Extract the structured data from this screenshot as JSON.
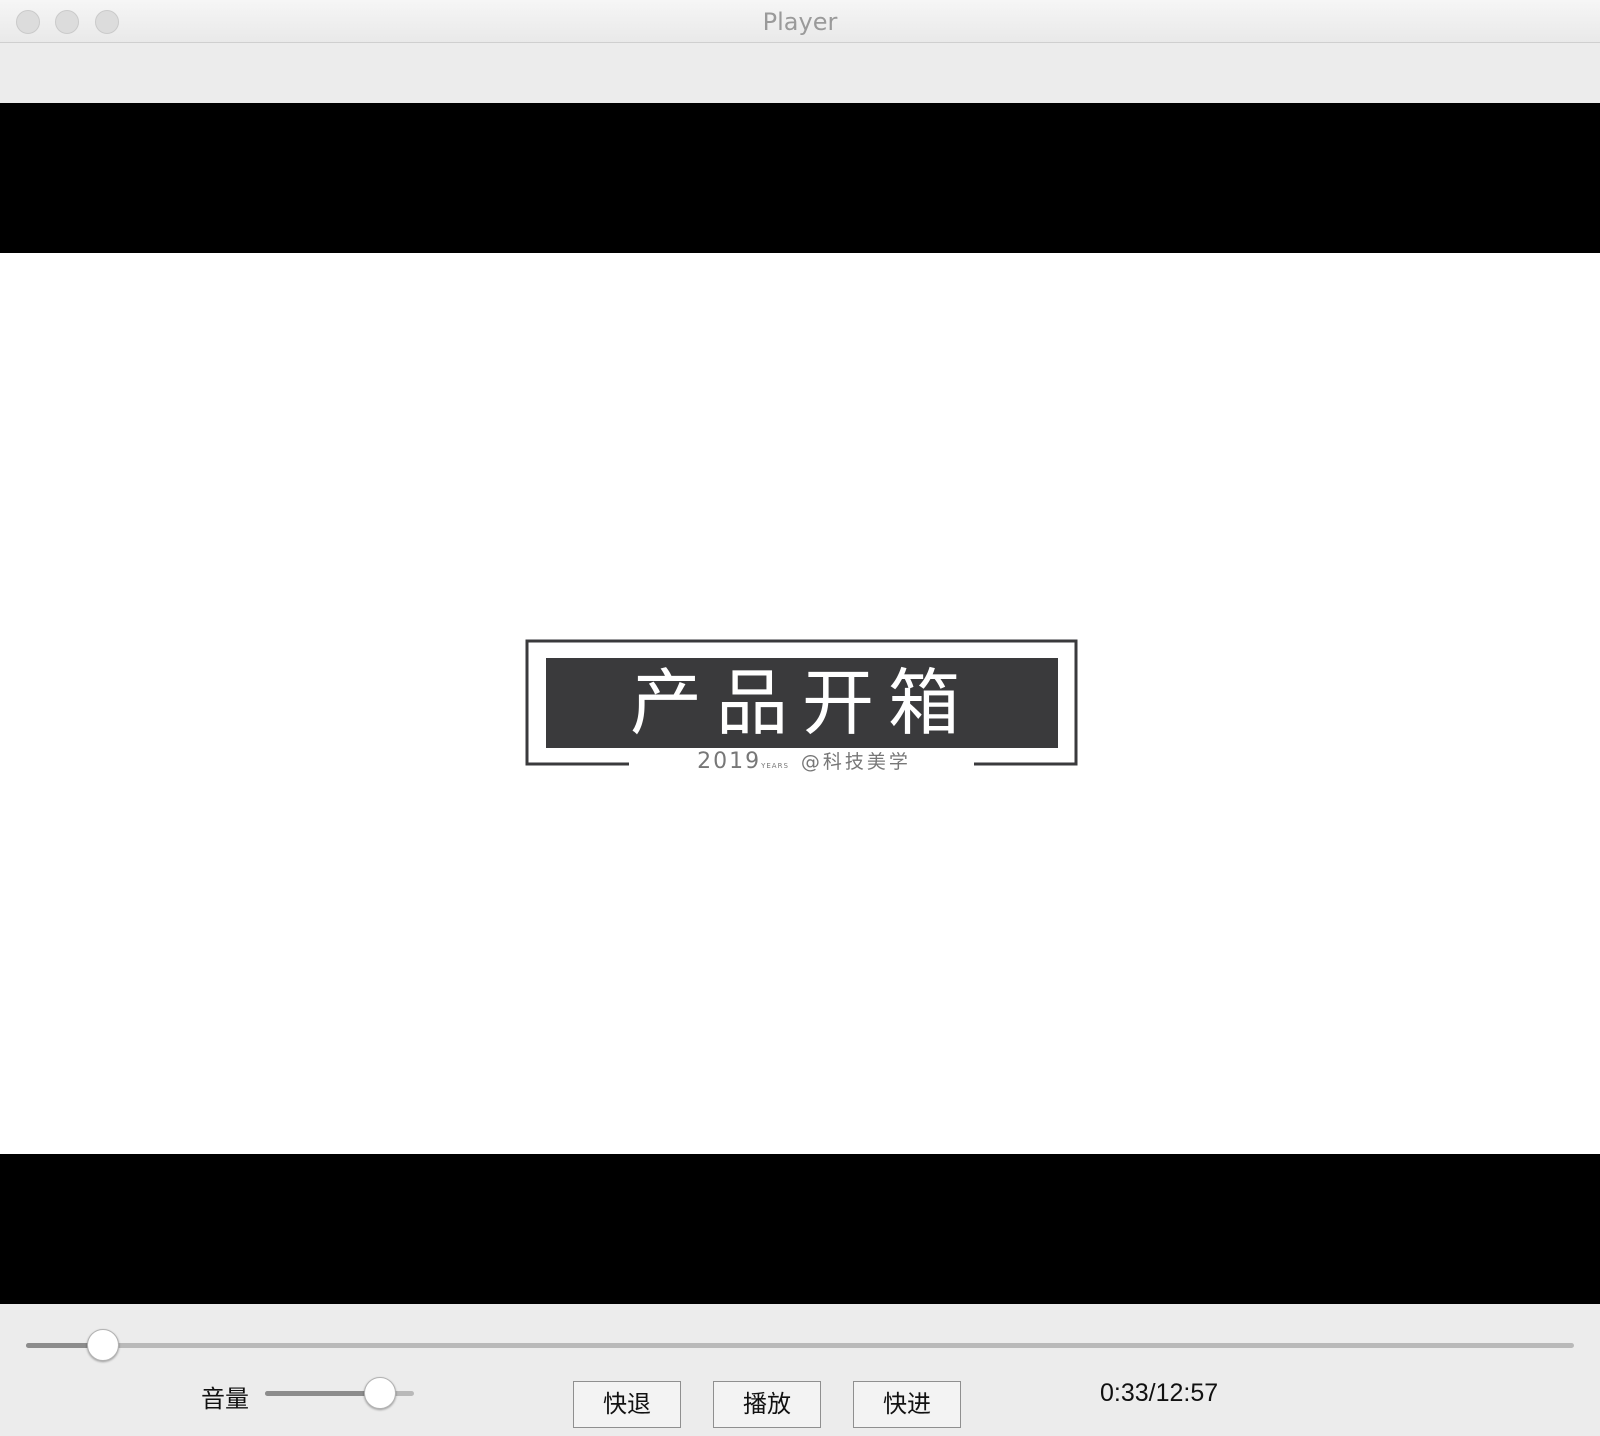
{
  "window": {
    "title": "Player"
  },
  "video": {
    "logo_title": "产品开箱",
    "logo_subtitle_year": "2019",
    "logo_subtitle_small": "YEARS",
    "logo_subtitle_author": "@科技美学"
  },
  "controls": {
    "seek_progress": 0.05,
    "volume_label": "音量",
    "volume_level": 0.77,
    "rewind_label": "快退",
    "play_label": "播放",
    "forward_label": "快进",
    "time_display": "0:33/12:57"
  },
  "colors": {
    "letterbox": "#000000",
    "logo_fill": "#3a3a3c",
    "window_bg": "#ececec"
  },
  "icons": [
    "close-button-icon",
    "minimize-button-icon",
    "zoom-button-icon"
  ]
}
